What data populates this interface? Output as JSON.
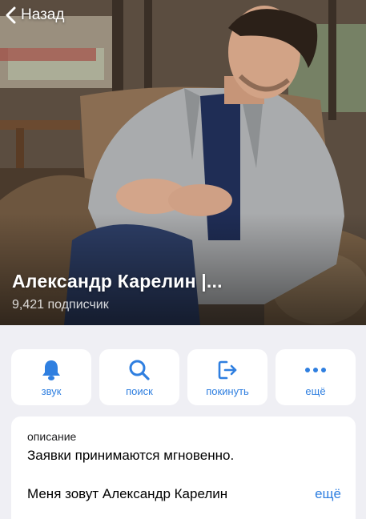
{
  "nav": {
    "back_label": "Назад"
  },
  "channel": {
    "title": "Александр Карелин |...",
    "subscribers": "9,421 подписчик"
  },
  "actions": [
    {
      "label": "звук",
      "icon": "bell-icon"
    },
    {
      "label": "поиск",
      "icon": "search-icon"
    },
    {
      "label": "покинуть",
      "icon": "leave-icon"
    },
    {
      "label": "ещё",
      "icon": "more-icon"
    }
  ],
  "description": {
    "label": "описание",
    "line1": "Заявки принимаются мгновенно.",
    "line2": "Меня зовут Александр Карелин",
    "more": "ещё"
  },
  "colors": {
    "accent": "#2f7fe0",
    "background": "#efeff4",
    "card": "#ffffff"
  }
}
